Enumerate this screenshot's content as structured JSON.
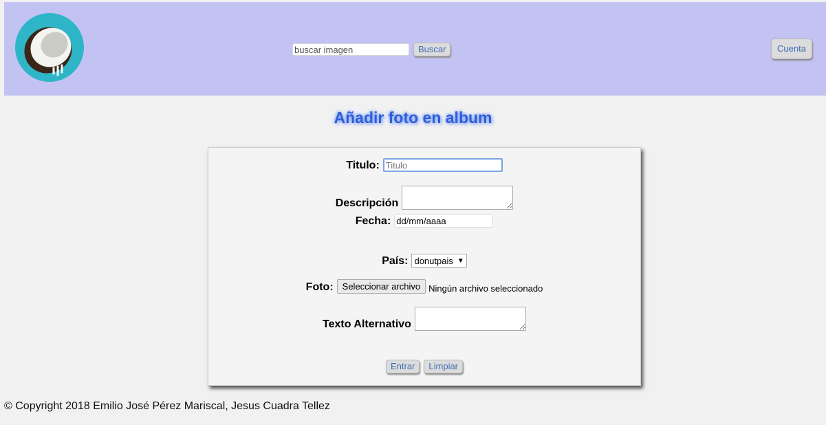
{
  "header": {
    "logo_icon": "coconut-logo-icon",
    "search": {
      "placeholder": "buscar imagen",
      "value": "",
      "button_label": "Buscar"
    },
    "account_label": "Cuenta"
  },
  "page": {
    "title": "Añadir foto en album"
  },
  "form": {
    "titulo": {
      "label": "Titulo:",
      "placeholder": "Titulo",
      "value": ""
    },
    "descripcion": {
      "label": "Descripción",
      "value": ""
    },
    "fecha": {
      "label": "Fecha:",
      "value": "dd/mm/aaaa"
    },
    "pais": {
      "label": "País:",
      "selected": "donutpais"
    },
    "foto": {
      "label": "Foto:",
      "button_label": "Seleccionar archivo",
      "status": "Ningún archivo seleccionado"
    },
    "alt": {
      "label": "Texto Alternativo",
      "value": ""
    },
    "submit_label": "Entrar",
    "reset_label": "Limpiar"
  },
  "footer": {
    "copyright": "© Copyright 2018 Emilio José Pérez Mariscal, Jesus Cuadra Tellez"
  },
  "colors": {
    "header_bg": "#c3c3f3",
    "title": "#2f5fd8",
    "button_text": "#3e6bb5",
    "logo_ring": "#2fb5c8"
  }
}
